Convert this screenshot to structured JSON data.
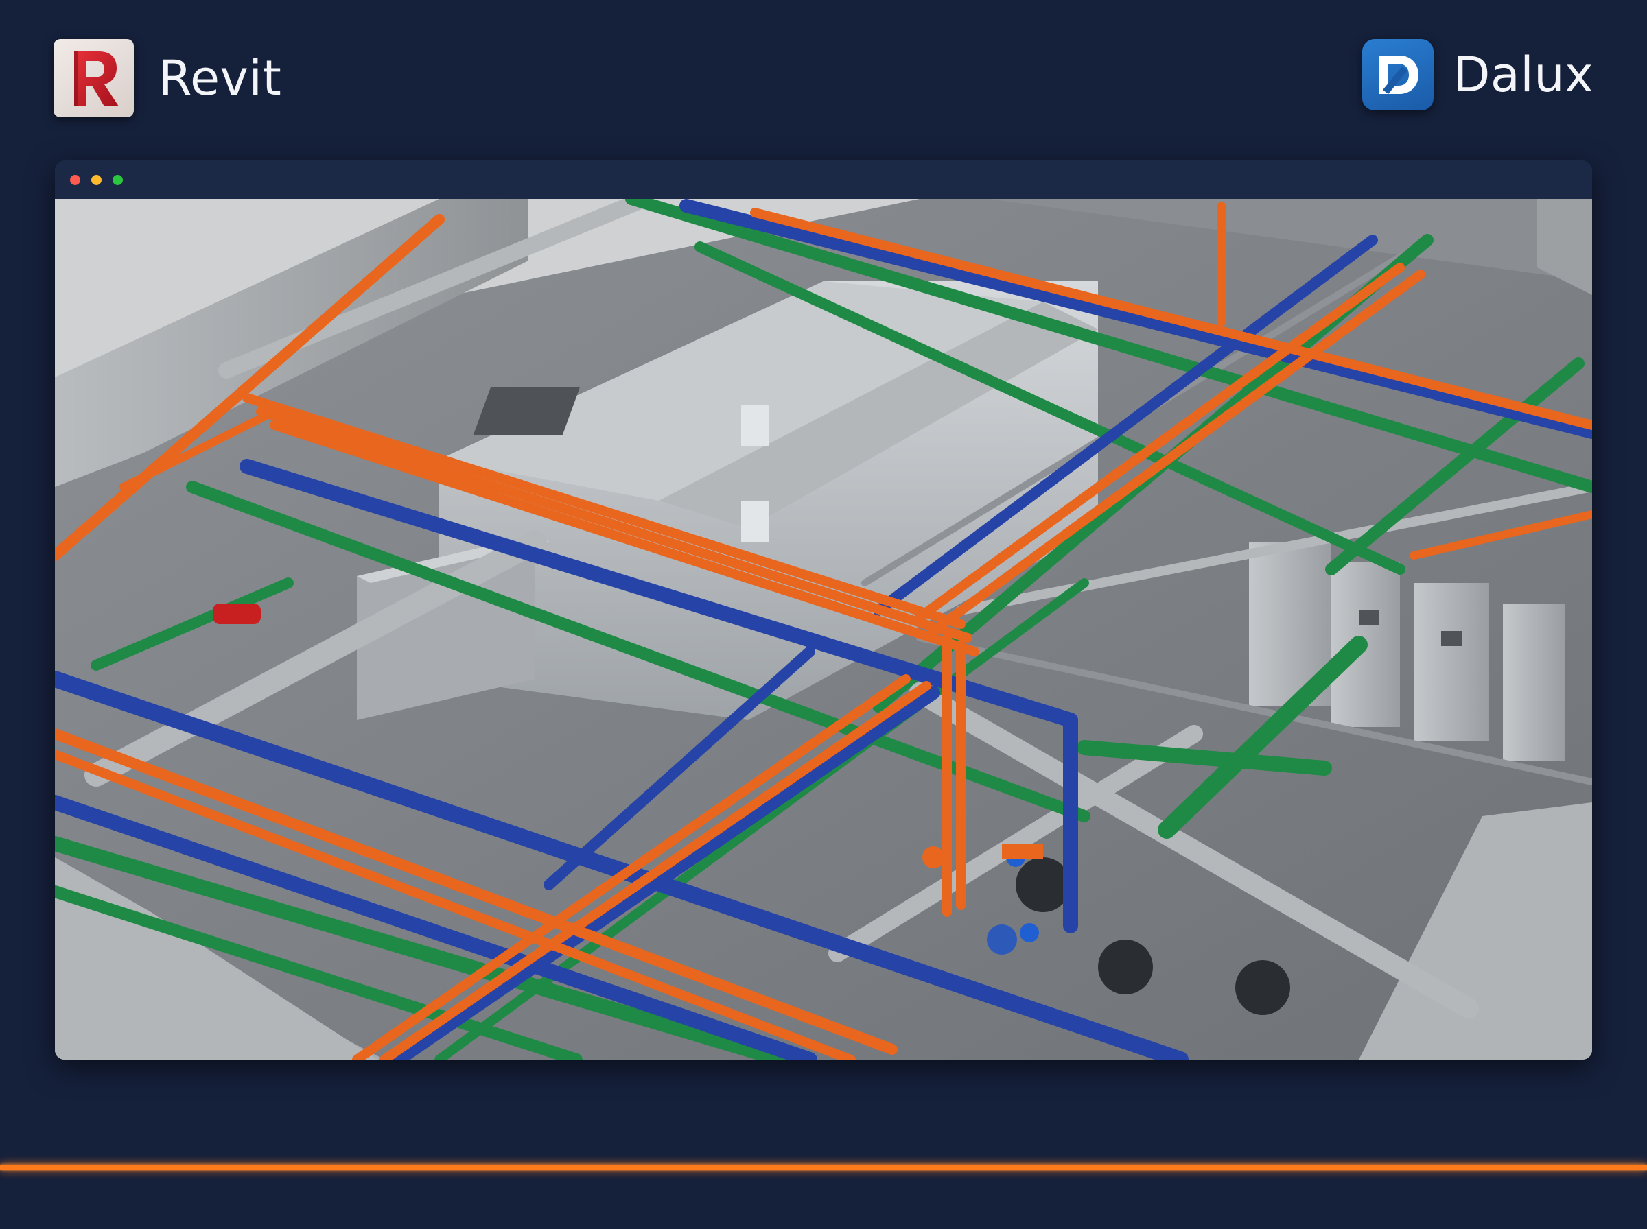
{
  "header": {
    "left_app": {
      "name": "Revit",
      "icon": "revit-logo-icon",
      "color": "#c8232c"
    },
    "right_app": {
      "name": "Dalux",
      "icon": "dalux-logo-icon",
      "color": "#1f6fc5"
    }
  },
  "window": {
    "controls": [
      "close",
      "minimize",
      "maximize"
    ],
    "content": "3d-mep-model-render"
  },
  "colors": {
    "background": "#15203b",
    "accent": "#ff7a1a",
    "pipe_orange": "#e8661e",
    "pipe_blue": "#2643a8",
    "pipe_green": "#1f8a45",
    "duct_grey": "#a9adb1"
  }
}
